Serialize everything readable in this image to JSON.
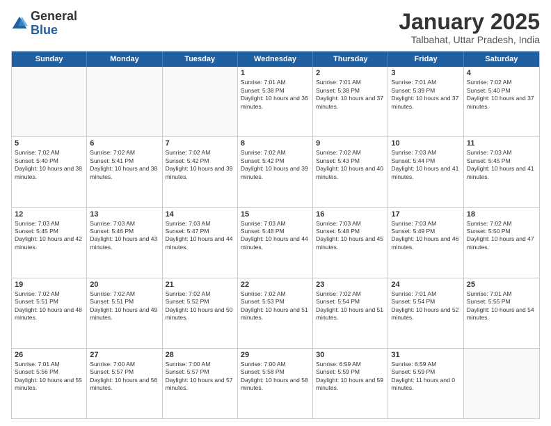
{
  "header": {
    "logo_general": "General",
    "logo_blue": "Blue",
    "month_title": "January 2025",
    "subtitle": "Talbahat, Uttar Pradesh, India"
  },
  "calendar": {
    "days_of_week": [
      "Sunday",
      "Monday",
      "Tuesday",
      "Wednesday",
      "Thursday",
      "Friday",
      "Saturday"
    ],
    "rows": [
      [
        {
          "day": "",
          "empty": true
        },
        {
          "day": "",
          "empty": true
        },
        {
          "day": "",
          "empty": true
        },
        {
          "day": "1",
          "sunrise": "7:01 AM",
          "sunset": "5:38 PM",
          "daylight": "10 hours and 36 minutes."
        },
        {
          "day": "2",
          "sunrise": "7:01 AM",
          "sunset": "5:38 PM",
          "daylight": "10 hours and 37 minutes."
        },
        {
          "day": "3",
          "sunrise": "7:01 AM",
          "sunset": "5:39 PM",
          "daylight": "10 hours and 37 minutes."
        },
        {
          "day": "4",
          "sunrise": "7:02 AM",
          "sunset": "5:40 PM",
          "daylight": "10 hours and 37 minutes."
        }
      ],
      [
        {
          "day": "5",
          "sunrise": "7:02 AM",
          "sunset": "5:40 PM",
          "daylight": "10 hours and 38 minutes."
        },
        {
          "day": "6",
          "sunrise": "7:02 AM",
          "sunset": "5:41 PM",
          "daylight": "10 hours and 38 minutes."
        },
        {
          "day": "7",
          "sunrise": "7:02 AM",
          "sunset": "5:42 PM",
          "daylight": "10 hours and 39 minutes."
        },
        {
          "day": "8",
          "sunrise": "7:02 AM",
          "sunset": "5:42 PM",
          "daylight": "10 hours and 39 minutes."
        },
        {
          "day": "9",
          "sunrise": "7:02 AM",
          "sunset": "5:43 PM",
          "daylight": "10 hours and 40 minutes."
        },
        {
          "day": "10",
          "sunrise": "7:03 AM",
          "sunset": "5:44 PM",
          "daylight": "10 hours and 41 minutes."
        },
        {
          "day": "11",
          "sunrise": "7:03 AM",
          "sunset": "5:45 PM",
          "daylight": "10 hours and 41 minutes."
        }
      ],
      [
        {
          "day": "12",
          "sunrise": "7:03 AM",
          "sunset": "5:45 PM",
          "daylight": "10 hours and 42 minutes."
        },
        {
          "day": "13",
          "sunrise": "7:03 AM",
          "sunset": "5:46 PM",
          "daylight": "10 hours and 43 minutes."
        },
        {
          "day": "14",
          "sunrise": "7:03 AM",
          "sunset": "5:47 PM",
          "daylight": "10 hours and 44 minutes."
        },
        {
          "day": "15",
          "sunrise": "7:03 AM",
          "sunset": "5:48 PM",
          "daylight": "10 hours and 44 minutes."
        },
        {
          "day": "16",
          "sunrise": "7:03 AM",
          "sunset": "5:48 PM",
          "daylight": "10 hours and 45 minutes."
        },
        {
          "day": "17",
          "sunrise": "7:03 AM",
          "sunset": "5:49 PM",
          "daylight": "10 hours and 46 minutes."
        },
        {
          "day": "18",
          "sunrise": "7:02 AM",
          "sunset": "5:50 PM",
          "daylight": "10 hours and 47 minutes."
        }
      ],
      [
        {
          "day": "19",
          "sunrise": "7:02 AM",
          "sunset": "5:51 PM",
          "daylight": "10 hours and 48 minutes."
        },
        {
          "day": "20",
          "sunrise": "7:02 AM",
          "sunset": "5:51 PM",
          "daylight": "10 hours and 49 minutes."
        },
        {
          "day": "21",
          "sunrise": "7:02 AM",
          "sunset": "5:52 PM",
          "daylight": "10 hours and 50 minutes."
        },
        {
          "day": "22",
          "sunrise": "7:02 AM",
          "sunset": "5:53 PM",
          "daylight": "10 hours and 51 minutes."
        },
        {
          "day": "23",
          "sunrise": "7:02 AM",
          "sunset": "5:54 PM",
          "daylight": "10 hours and 51 minutes."
        },
        {
          "day": "24",
          "sunrise": "7:01 AM",
          "sunset": "5:54 PM",
          "daylight": "10 hours and 52 minutes."
        },
        {
          "day": "25",
          "sunrise": "7:01 AM",
          "sunset": "5:55 PM",
          "daylight": "10 hours and 54 minutes."
        }
      ],
      [
        {
          "day": "26",
          "sunrise": "7:01 AM",
          "sunset": "5:56 PM",
          "daylight": "10 hours and 55 minutes."
        },
        {
          "day": "27",
          "sunrise": "7:00 AM",
          "sunset": "5:57 PM",
          "daylight": "10 hours and 56 minutes."
        },
        {
          "day": "28",
          "sunrise": "7:00 AM",
          "sunset": "5:57 PM",
          "daylight": "10 hours and 57 minutes."
        },
        {
          "day": "29",
          "sunrise": "7:00 AM",
          "sunset": "5:58 PM",
          "daylight": "10 hours and 58 minutes."
        },
        {
          "day": "30",
          "sunrise": "6:59 AM",
          "sunset": "5:59 PM",
          "daylight": "10 hours and 59 minutes."
        },
        {
          "day": "31",
          "sunrise": "6:59 AM",
          "sunset": "5:59 PM",
          "daylight": "11 hours and 0 minutes."
        },
        {
          "day": "",
          "empty": true
        }
      ]
    ]
  }
}
